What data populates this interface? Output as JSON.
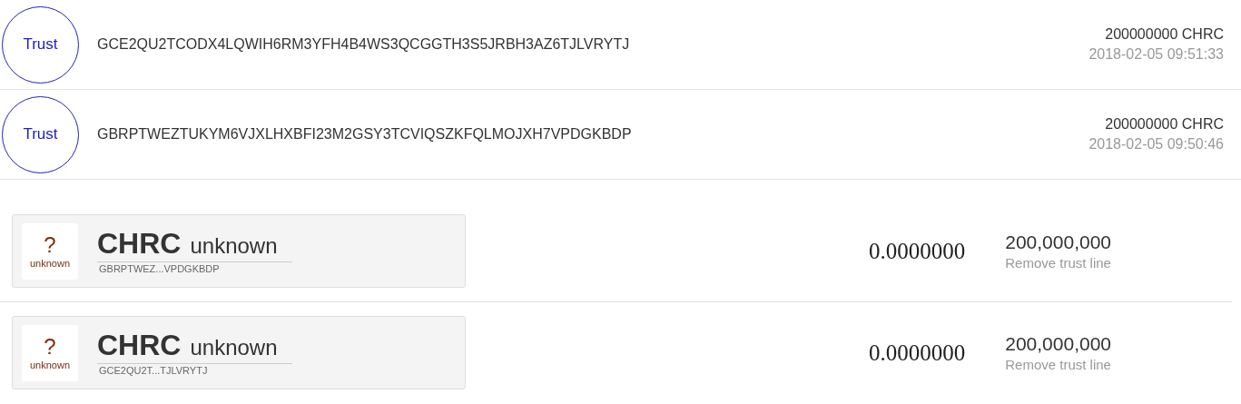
{
  "operations": [
    {
      "badge": "Trust",
      "account": "GCE2QU2TCODX4LQWIH6RM3YFH4B4WS3QCGGTH3S5JRBH3AZ6TJLVRYTJ",
      "amount": "200000000 CHRC",
      "time": "2018-02-05 09:51:33"
    },
    {
      "badge": "Trust",
      "account": "GBRPTWEZTUKYM6VJXLHXBFI23M2GSY3TCVIQSZKFQLMOJXH7VPDGKBDP",
      "amount": "200000000 CHRC",
      "time": "2018-02-05 09:50:46"
    }
  ],
  "balances": [
    {
      "icon_mark": "?",
      "icon_label": "unknown",
      "code": "CHRC",
      "domain": "unknown",
      "issuer": "GBRPTWEZ...VPDGKBDP",
      "balance": "0.0000000",
      "limit": "200,000,000",
      "action": "Remove trust line"
    },
    {
      "icon_mark": "?",
      "icon_label": "unknown",
      "code": "CHRC",
      "domain": "unknown",
      "issuer": "GCE2QU2T...TJLVRYTJ",
      "balance": "0.0000000",
      "limit": "200,000,000",
      "action": "Remove trust line"
    }
  ]
}
